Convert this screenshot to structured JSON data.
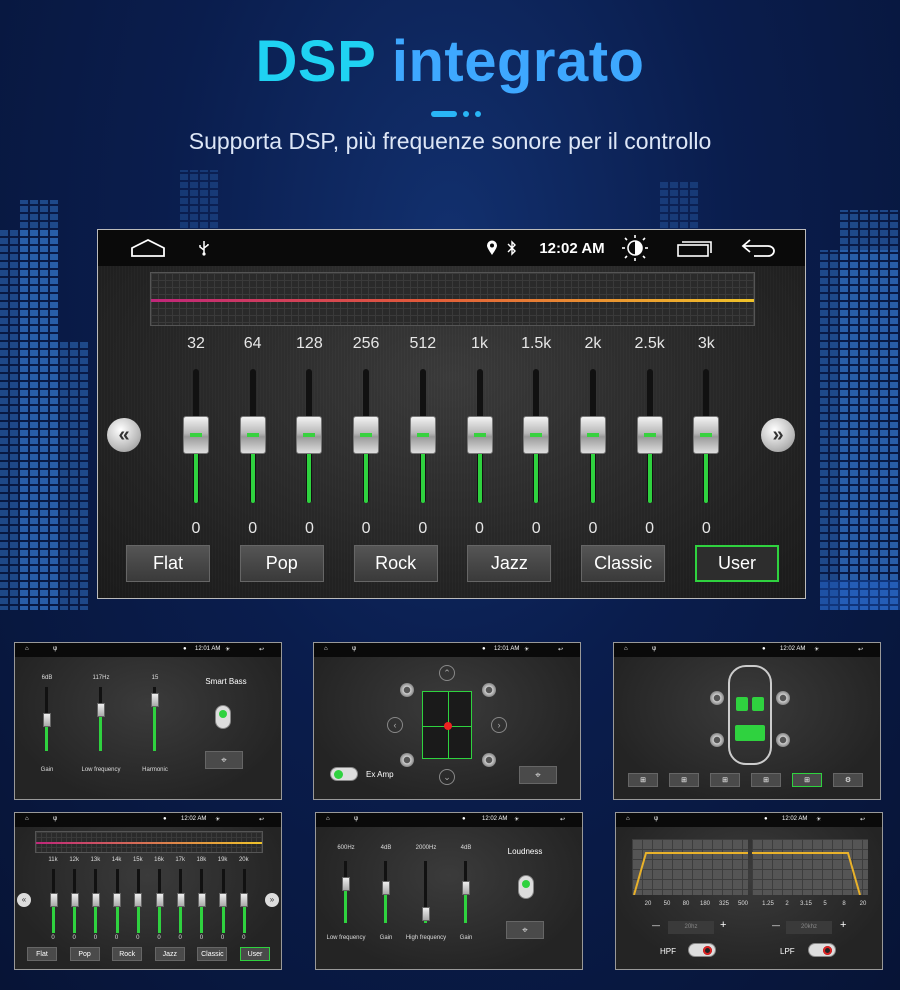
{
  "header": {
    "title_part1": "DSP",
    "title_part2": "integrato",
    "subtitle": "Supporta DSP, più frequenze sonore per il controllo"
  },
  "colors": {
    "accent_cyan": "#1fd2f2",
    "accent_blue": "#3ea8ff",
    "active_green": "#2fd23f",
    "background_navy": "#0a1d4d"
  },
  "main_screen": {
    "status_bar": {
      "icons": [
        "home-icon",
        "usb-icon",
        "location-icon",
        "bluetooth-icon",
        "brightness-icon",
        "recent-apps-icon",
        "back-icon"
      ],
      "time": "12:02 AM"
    },
    "bands": [
      {
        "freq": "32",
        "value": "0"
      },
      {
        "freq": "64",
        "value": "0"
      },
      {
        "freq": "128",
        "value": "0"
      },
      {
        "freq": "256",
        "value": "0"
      },
      {
        "freq": "512",
        "value": "0"
      },
      {
        "freq": "1k",
        "value": "0"
      },
      {
        "freq": "1.5k",
        "value": "0"
      },
      {
        "freq": "2k",
        "value": "0"
      },
      {
        "freq": "2.5k",
        "value": "0"
      },
      {
        "freq": "3k",
        "value": "0"
      }
    ],
    "nav_prev": "«",
    "nav_next": "»",
    "presets": [
      "Flat",
      "Pop",
      "Rock",
      "Jazz",
      "Classic",
      "User"
    ],
    "active_preset": "User"
  },
  "thumbnails": {
    "t1": {
      "time": "12:01 AM",
      "sliders": [
        {
          "top": "6dB",
          "bottom": "Gain"
        },
        {
          "top": "117Hz",
          "bottom": "Low frequency"
        },
        {
          "top": "15",
          "bottom": "Harmonic"
        }
      ],
      "smart_bass": "Smart Bass"
    },
    "t2": {
      "time": "12:01 AM",
      "ex_amp": "Ex Amp"
    },
    "t3": {
      "time": "12:02 AM"
    },
    "t4": {
      "time": "12:02 AM",
      "bands": [
        "11k",
        "12k",
        "13k",
        "14k",
        "15k",
        "16k",
        "17k",
        "18k",
        "19k",
        "20k"
      ],
      "values": [
        "0",
        "0",
        "0",
        "0",
        "0",
        "0",
        "0",
        "0",
        "0",
        "0"
      ],
      "presets": [
        "Flat",
        "Pop",
        "Rock",
        "Jazz",
        "Classic",
        "User"
      ]
    },
    "t5": {
      "time": "12:02 AM",
      "sliders": [
        {
          "top": "600Hz",
          "bottom": "Low frequency"
        },
        {
          "top": "4dB",
          "bottom": "Gain"
        },
        {
          "top": "2000Hz",
          "bottom": "High frequency"
        },
        {
          "top": "4dB",
          "bottom": "Gain"
        }
      ],
      "loudness": "Loudness"
    },
    "t6": {
      "time": "12:02 AM",
      "hpf_ticks": [
        "20",
        "50",
        "80",
        "180",
        "325",
        "500"
      ],
      "lpf_ticks": [
        "1.25",
        "2",
        "3.15",
        "5",
        "8",
        "20"
      ],
      "hpf_value": "20hz",
      "lpf_value": "20khz",
      "minus": "—",
      "plus": "+",
      "hpf_label": "HPF",
      "lpf_label": "LPF"
    }
  }
}
